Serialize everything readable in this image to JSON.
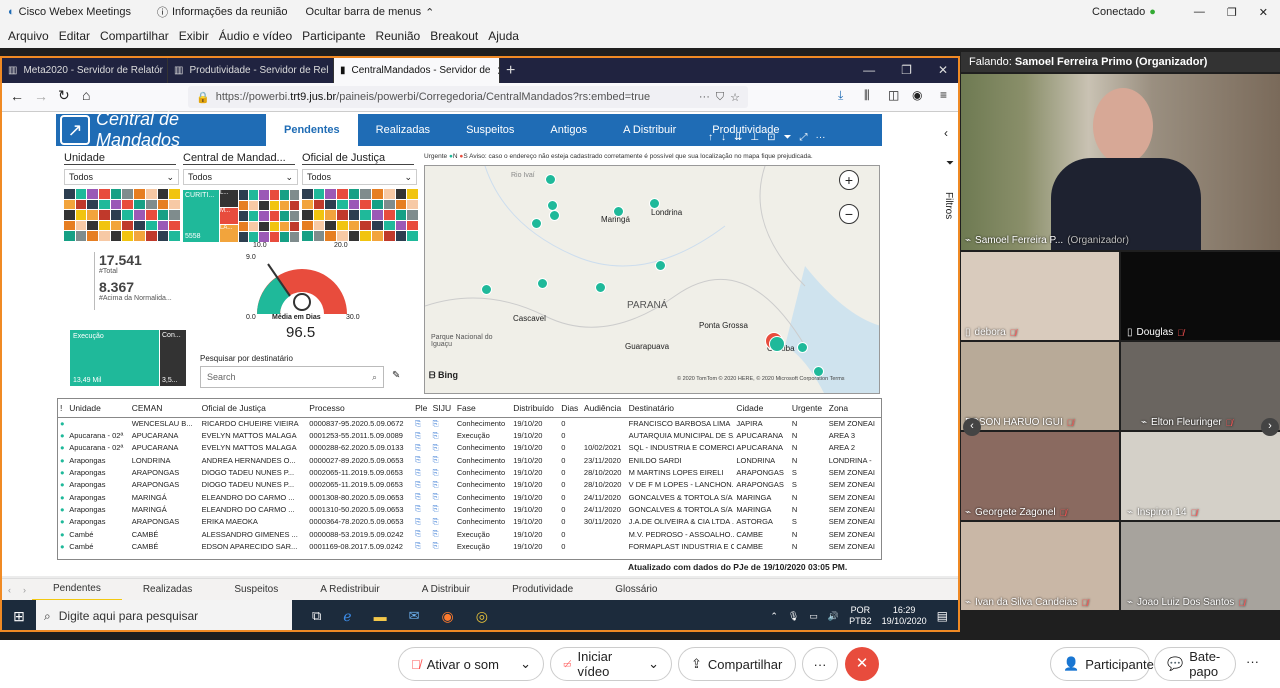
{
  "webex": {
    "app": "Cisco Webex Meetings",
    "info": "Informações da reunião",
    "hide": "Ocultar barra de menus",
    "status": "Conectado",
    "menu": [
      "Arquivo",
      "Editar",
      "Compartilhar",
      "Exibir",
      "Áudio e vídeo",
      "Participante",
      "Reunião",
      "Breakout",
      "Ajuda"
    ]
  },
  "browser": {
    "tabs": [
      "Meta2020 - Servidor de Relatór",
      "Produtividade - Servidor de Rel",
      "CentralMandados - Servidor de"
    ],
    "url_prefix": "https://powerbi.",
    "url_host": "trt9.jus.br",
    "url_path": "/paineis/powerbi/Corregedoria/CentralMandados?rs:embed=true"
  },
  "pbi": {
    "title": "Central de Mandados",
    "tabs": [
      "Pendentes",
      "Realizadas",
      "Suspeitos",
      "Antigos",
      "A Distribuir",
      "Produtividade"
    ],
    "filters": [
      {
        "label": "Unidade",
        "value": "Todos"
      },
      {
        "label": "Central de Mandad...",
        "value": "Todos"
      },
      {
        "label": "Oficial de Justiça",
        "value": "Todos"
      }
    ],
    "tree2_labels": [
      "CURITI...",
      "5558",
      "L...",
      "M...",
      "LA..."
    ],
    "total": "17.541",
    "total_label": "#Total",
    "above": "8.367",
    "above_label": "#Acima da Normalida...",
    "gauge": {
      "min": "0.0",
      "max": "30.0",
      "t1": "10.0",
      "t2": "20.0",
      "t3": "9.0",
      "label": "Média em Dias",
      "value": "96.5"
    },
    "exec_label": "Execução",
    "exec_value": "13,49 Mil",
    "con_label": "Con...",
    "con_value": "3,5...",
    "search_label": "Pesquisar por destinatário",
    "search_placeholder": "Search",
    "map": {
      "legend": "Urgente",
      "leg_n": "N",
      "leg_s": "S",
      "warning": "Aviso: caso o endereço não esteja cadastrado corretamente é possível que sua localização no mapa fique prejudicada.",
      "cities": [
        "Maringá",
        "Londrina",
        "PARANÁ",
        "Cascavel",
        "Ponta Grossa",
        "Guarapuava",
        "Curitiba",
        "Parque Nacional do Iguaçu"
      ],
      "rio": "Rio Ivaí",
      "bing": "Bing",
      "copyright": "© 2020 TomTom © 2020 HERE, © 2020 Microsoft Corporation  Terms"
    },
    "updated": "Atualizado com dados do PJe de 19/10/2020 03:05 PM.",
    "bottom_tabs": [
      "Pendentes",
      "Realizadas",
      "Suspeitos",
      "A Redistribuir",
      "A Distribuir",
      "Produtividade",
      "Glossário"
    ]
  },
  "table": {
    "headers": [
      "!",
      "Unidade",
      "CEMAN",
      "Oficial de Justiça",
      "Processo",
      "Ple",
      "SIJU",
      "Fase",
      "Distribuído",
      "Dias",
      "Audiência",
      "Destinatário",
      "Cidade",
      "Urgente",
      "Zona"
    ],
    "rows": [
      [
        "",
        "",
        "WENCESLAU B...",
        "RICARDO CHUEIRE VIEIRA",
        "0000837-95.2020.5.09.0672",
        "",
        "",
        "Conhecimento",
        "19/10/20",
        "0",
        "",
        "FRANCISCO BARBOSA LIMA",
        "JAPIRA",
        "N",
        "SEM ZONEAI"
      ],
      [
        "",
        "Apucarana - 02ª",
        "APUCARANA",
        "EVELYN MATTOS MALAGA",
        "0001253-55.2011.5.09.0089",
        "",
        "",
        "Execução",
        "19/10/20",
        "0",
        "",
        "AUTARQUIA MUNICIPAL DE S...",
        "APUCARANA",
        "N",
        "AREA 3"
      ],
      [
        "",
        "Apucarana - 02ª",
        "APUCARANA",
        "EVELYN MATTOS MALAGA",
        "0000288-62.2020.5.09.0133",
        "",
        "",
        "Conhecimento",
        "19/10/20",
        "0",
        "10/02/2021",
        "SQL - INDUSTRIA E COMERCI...",
        "APUCARANA",
        "N",
        "AREA 2"
      ],
      [
        "",
        "Arapongas",
        "LONDRINA",
        "ANDREA HERNANDES O...",
        "0000027-89.2020.5.09.0653",
        "",
        "",
        "Conhecimento",
        "19/10/20",
        "0",
        "23/11/2020",
        "ENILDO SARDI",
        "LONDRINA",
        "N",
        "LONDRINA -"
      ],
      [
        "",
        "Arapongas",
        "ARAPONGAS",
        "DIOGO TADEU NUNES P...",
        "0002065-11.2019.5.09.0653",
        "",
        "",
        "Conhecimento",
        "19/10/20",
        "0",
        "28/10/2020",
        "M MARTINS LOPES EIRELI",
        "ARAPONGAS",
        "S",
        "SEM ZONEAI"
      ],
      [
        "",
        "Arapongas",
        "ARAPONGAS",
        "DIOGO TADEU NUNES P...",
        "0002065-11.2019.5.09.0653",
        "",
        "",
        "Conhecimento",
        "19/10/20",
        "0",
        "28/10/2020",
        "V DE F M LOPES - LANCHON...",
        "ARAPONGAS",
        "S",
        "SEM ZONEAI"
      ],
      [
        "",
        "Arapongas",
        "MARINGÁ",
        "ELEANDRO DO CARMO ...",
        "0001308-80.2020.5.09.0653",
        "",
        "",
        "Conhecimento",
        "19/10/20",
        "0",
        "24/11/2020",
        "GONCALVES & TORTOLA S/A",
        "MARINGA",
        "N",
        "SEM ZONEAI"
      ],
      [
        "",
        "Arapongas",
        "MARINGÁ",
        "ELEANDRO DO CARMO ...",
        "0001310-50.2020.5.09.0653",
        "",
        "",
        "Conhecimento",
        "19/10/20",
        "0",
        "24/11/2020",
        "GONCALVES & TORTOLA S/A",
        "MARINGA",
        "N",
        "SEM ZONEAI"
      ],
      [
        "",
        "Arapongas",
        "ARAPONGAS",
        "ERIKA MAEOKA",
        "0000364-78.2020.5.09.0653",
        "",
        "",
        "Conhecimento",
        "19/10/20",
        "0",
        "30/11/2020",
        "J.A.DE OLIVEIRA & CIA LTDA ...",
        "ASTORGA",
        "S",
        "SEM ZONEAI"
      ],
      [
        "",
        "Cambé",
        "CAMBÉ",
        "ALESSANDRO GIMENES ...",
        "0000088-53.2019.5.09.0242",
        "",
        "",
        "Execução",
        "19/10/20",
        "0",
        "",
        "M.V. PEDROSO - ASSOALHO...",
        "CAMBE",
        "N",
        "SEM ZONEAI"
      ],
      [
        "",
        "Cambé",
        "CAMBÉ",
        "EDSON APARECIDO SAR...",
        "0001169-08.2017.5.09.0242",
        "",
        "",
        "Execução",
        "19/10/20",
        "0",
        "",
        "FORMAPLAST INDUSTRIA E C...",
        "CAMBE",
        "N",
        "SEM ZONEAI"
      ]
    ]
  },
  "taskbar": {
    "search": "Digite aqui para pesquisar",
    "lang1": "POR",
    "lang2": "PTB2",
    "time": "16:29",
    "date": "19/10/2020"
  },
  "panel": {
    "speaking_label": "Falando:",
    "speaking_name": "Samoel Ferreira Primo (Organizador)",
    "main_name": "Samoel Ferreira P...",
    "main_role": "(Organizador)",
    "participants": [
      "debora",
      "Douglas",
      "EDSON HARUO IGUI",
      "Elton Fleuringer",
      "Georgete Zagonel",
      "Inspiron 14",
      "Ivan da Silva Candeias",
      "Joao Luiz Dos Santos"
    ]
  },
  "toolbar": {
    "audio": "Ativar o som",
    "video": "Iniciar vídeo",
    "share": "Compartilhar",
    "participants": "Participantes",
    "chat": "Bate-papo"
  },
  "sidepane": {
    "filters": "Filtros"
  },
  "colors": {
    "accent": "#f08a24",
    "pbi_blue": "#1f6cb5",
    "teal": "#1fb99a",
    "end": "#e84c3d"
  }
}
